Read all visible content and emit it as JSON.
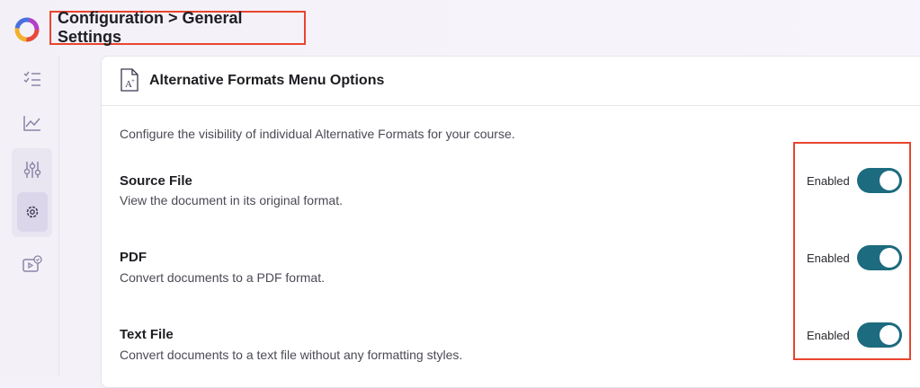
{
  "header": {
    "breadcrumb": "Configuration > General Settings"
  },
  "sidebar": {
    "items": [
      {
        "icon": "checklist-icon"
      },
      {
        "icon": "chart-line-icon"
      },
      {
        "icon": "sliders-icon"
      },
      {
        "icon": "gear-icon"
      },
      {
        "icon": "video-check-icon"
      }
    ]
  },
  "card": {
    "title": "Alternative Formats Menu Options",
    "intro": "Configure the visibility of individual Alternative Formats for your course.",
    "options": [
      {
        "name": "Source File",
        "description": "View the document in its original format.",
        "status": "Enabled"
      },
      {
        "name": "PDF",
        "description": "Convert documents to a PDF format.",
        "status": "Enabled"
      },
      {
        "name": "Text File",
        "description": "Convert documents to a text file without any formatting styles.",
        "status": "Enabled"
      }
    ]
  },
  "colors": {
    "accent": "#1c6b7e",
    "highlight": "#e8452f",
    "sidebar_active": "#dcd6ea"
  }
}
